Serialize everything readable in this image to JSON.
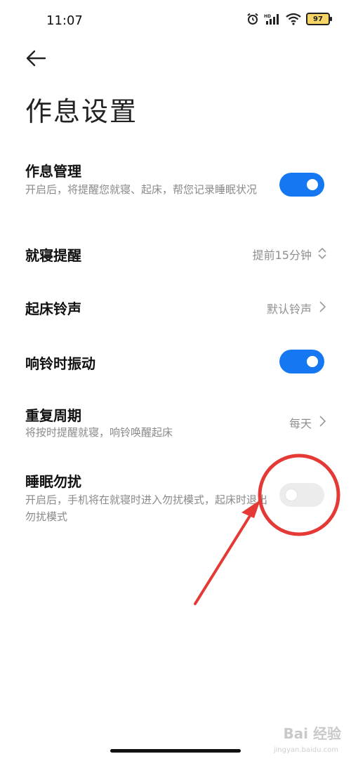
{
  "status_bar": {
    "time": "11:07",
    "battery": "97",
    "icons": [
      "alarm-icon",
      "hd-signal-icon",
      "wifi-icon",
      "battery-icon"
    ]
  },
  "header": {
    "back_icon": "arrow-left-icon",
    "title": "作息设置"
  },
  "settings": {
    "routine": {
      "title": "作息管理",
      "description": "开启后，将提醒您就寝、起床，帮您记录睡眠状况",
      "enabled": true
    },
    "bedtime": {
      "title": "就寝提醒",
      "value": "提前15分钟"
    },
    "ringtone": {
      "title": "起床铃声",
      "value": "默认铃声"
    },
    "vibrate": {
      "title": "响铃时振动",
      "enabled": true
    },
    "repeat": {
      "title": "重复周期",
      "description": "将按时提醒就寝，响铃唤醒起床",
      "value": "每天"
    },
    "dnd": {
      "title": "睡眠勿扰",
      "description": "开启后，手机将在就寝时进入勿扰模式，起床时退出勿扰模式",
      "enabled": false
    }
  },
  "watermark": {
    "text": "Bai 经验",
    "sub": "jingyan.baidu.com"
  },
  "colors": {
    "accent": "#1677f2",
    "annotation": "#e53935"
  }
}
